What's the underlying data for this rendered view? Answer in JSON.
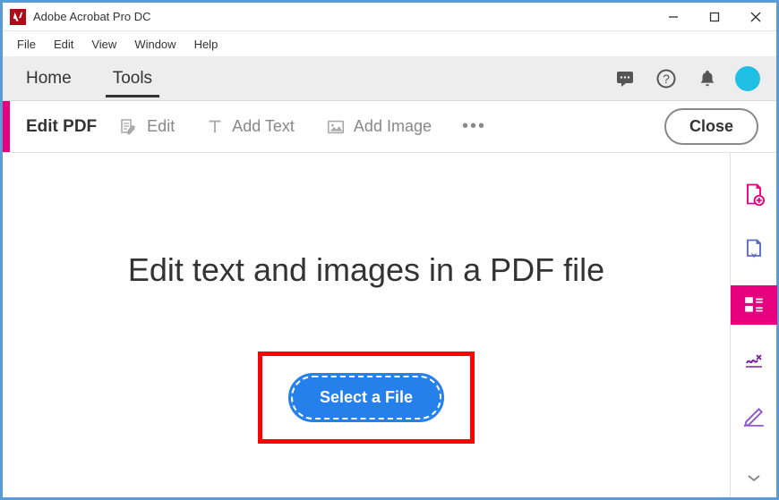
{
  "window": {
    "title": "Adobe Acrobat Pro DC"
  },
  "menubar": {
    "items": [
      "File",
      "Edit",
      "View",
      "Window",
      "Help"
    ]
  },
  "tabs": {
    "home": "Home",
    "tools": "Tools"
  },
  "toolbar": {
    "context_label": "Edit PDF",
    "edit": "Edit",
    "add_text": "Add Text",
    "add_image": "Add Image",
    "more": "•••",
    "close": "Close"
  },
  "main": {
    "headline": "Edit text and images in a PDF file",
    "select_file": "Select a File"
  }
}
